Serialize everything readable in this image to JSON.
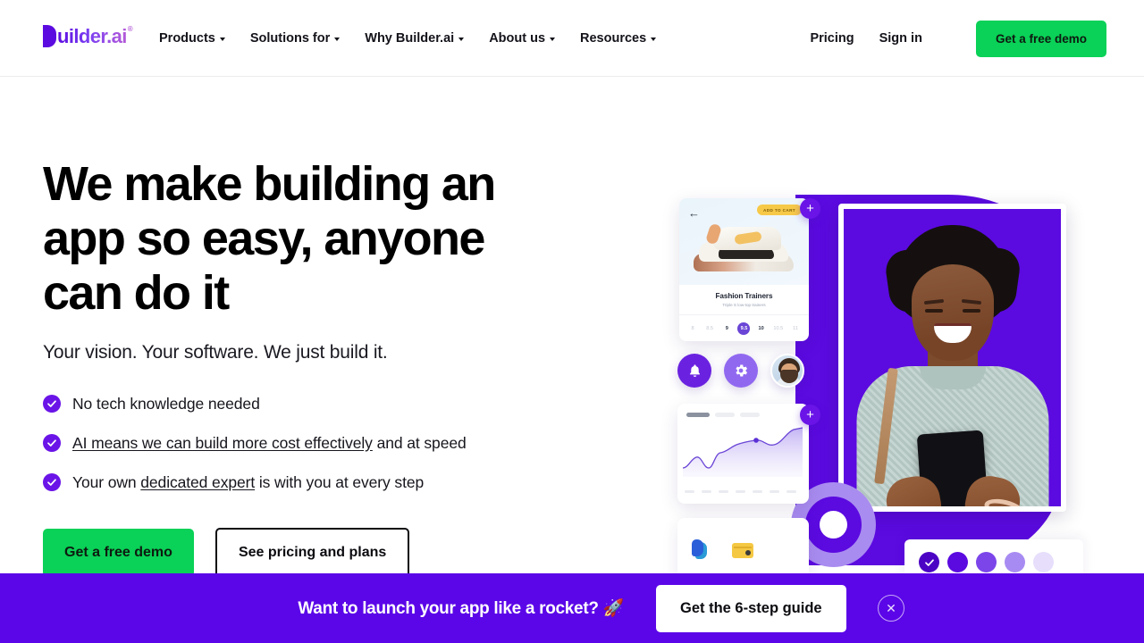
{
  "header": {
    "logo": {
      "mark": "B",
      "text": "uilder.ai",
      "registered": "®"
    },
    "nav": [
      {
        "label": "Products",
        "has_caret": true
      },
      {
        "label": "Solutions for",
        "has_caret": true
      },
      {
        "label": "Why Builder.ai",
        "has_caret": true
      },
      {
        "label": "About us",
        "has_caret": true
      },
      {
        "label": "Resources",
        "has_caret": true
      }
    ],
    "pricing_label": "Pricing",
    "signin_label": "Sign in",
    "demo_button_label": "Get a free demo"
  },
  "hero": {
    "headline": "We make building an app so easy, anyone can do it",
    "subheadline": "Your vision. Your software. We just build it.",
    "bullets": [
      {
        "text": "No tech knowledge needed",
        "link": ""
      },
      {
        "pre": "",
        "link": "AI means we can build more cost effectively",
        "post": " and at speed"
      },
      {
        "pre": "Your own ",
        "link": "dedicated expert",
        "post": " is with you at every step"
      }
    ],
    "primary_cta": "Get a free demo",
    "secondary_cta": "See pricing and plans"
  },
  "artwork": {
    "shoe_card": {
      "title": "Fashion Trainers",
      "subtitle": "Triple S low-top trainers",
      "add_to_cart": "Add to cart",
      "sizes": [
        "8",
        "8.5",
        "9",
        "9.5",
        "10",
        "10.5",
        "11"
      ],
      "selected_size": "9.5"
    },
    "icons": [
      "bell-icon",
      "gear-icon",
      "avatar"
    ],
    "payments": [
      "paypal-logo",
      "credit-card-icon"
    ],
    "plus_buttons": [
      "+",
      "+"
    ],
    "progress_dots": 5,
    "completed_dots": 1
  },
  "banner": {
    "message": "Want to launch your app like a rocket? 🚀",
    "button_label": "Get the 6-step guide",
    "close_label": "✕"
  },
  "colors": {
    "brand_purple": "#5b0ae0",
    "banner_purple": "#5b06e8",
    "green": "#0ad157",
    "check_purple": "#6a14e8",
    "text_dark": "#000000"
  }
}
